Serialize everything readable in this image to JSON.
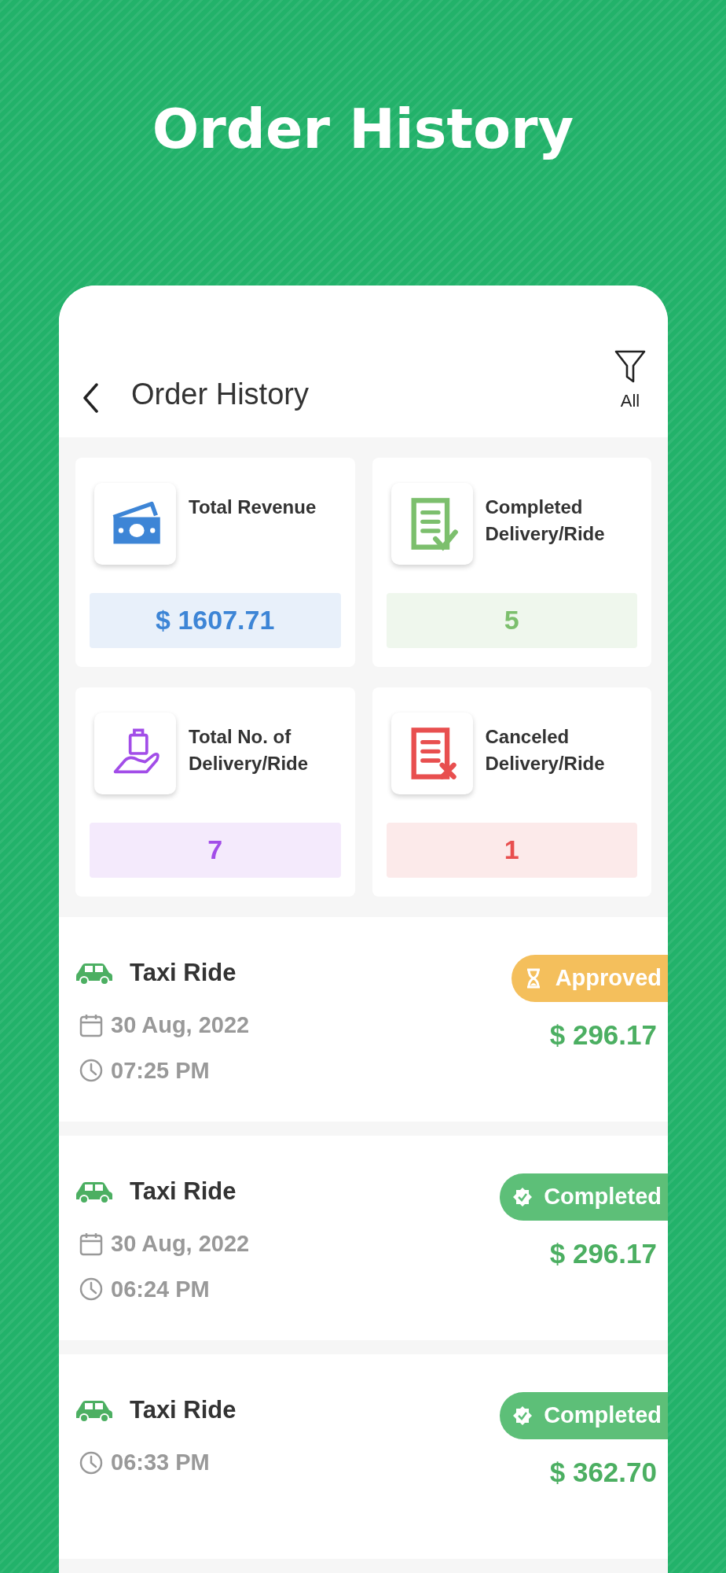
{
  "headline": "Order History",
  "header": {
    "title": "Order History",
    "filter_label": "All"
  },
  "stats": [
    {
      "kind": "revenue",
      "label": "Total Revenue",
      "value": "$ 1607.71",
      "color": "#3d85d6"
    },
    {
      "kind": "completed",
      "label": "Completed Delivery/Ride",
      "value": "5",
      "color": "#7cbf6d"
    },
    {
      "kind": "total",
      "label": "Total No. of Delivery/Ride",
      "value": "7",
      "color": "#a24de8"
    },
    {
      "kind": "canceled",
      "label": "Canceled Delivery/Ride",
      "value": "1",
      "color": "#e84f4f"
    }
  ],
  "orders": [
    {
      "title": "Taxi Ride",
      "date": "30 Aug, 2022",
      "time": "07:25 PM",
      "status": {
        "kind": "approved",
        "label": "Approved",
        "color": "#f4bf5c"
      },
      "price": "$ 296.17"
    },
    {
      "title": "Taxi Ride",
      "date": "30 Aug, 2022",
      "time": "06:24 PM",
      "status": {
        "kind": "completed",
        "label": "Completed",
        "color": "#5dbf78"
      },
      "price": "$ 296.17"
    },
    {
      "title": "Taxi Ride",
      "time": "06:33 PM",
      "status": {
        "kind": "completed",
        "label": "Completed",
        "color": "#5dbf78"
      },
      "price": "$ 362.70"
    }
  ]
}
